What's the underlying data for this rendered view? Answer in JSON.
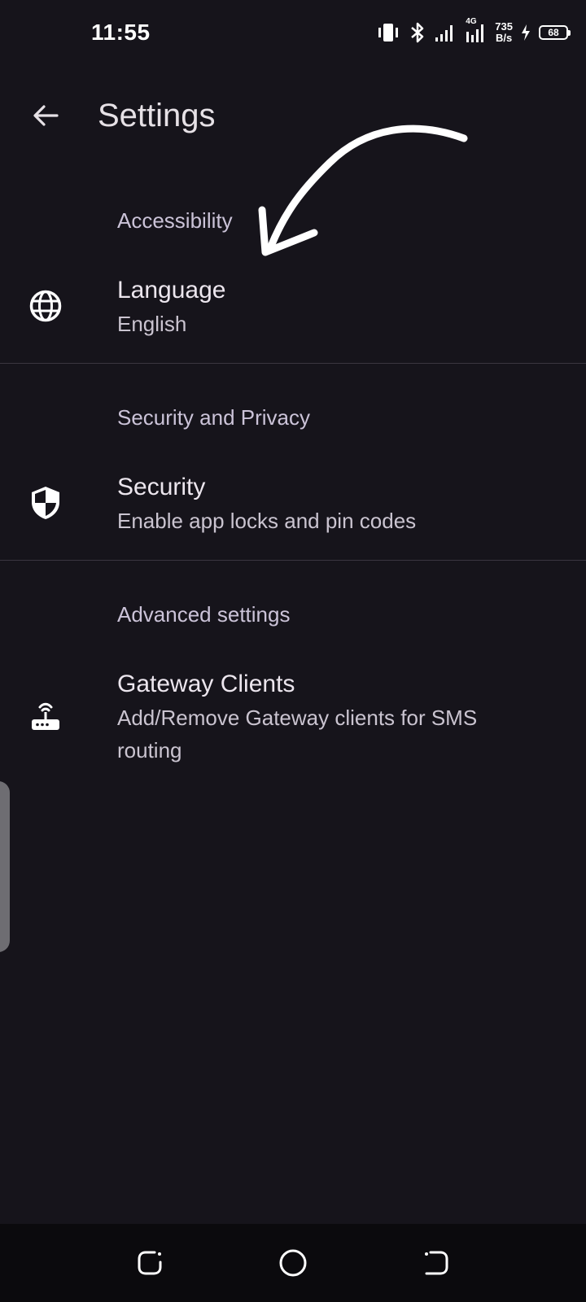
{
  "status_bar": {
    "time": "11:55",
    "network_speed_value": "735",
    "network_speed_unit": "B/s",
    "network_type": "4G",
    "battery_level": "68"
  },
  "app_bar": {
    "title": "Settings",
    "back_icon": "arrow-back-icon"
  },
  "sections": [
    {
      "header": "Accessibility",
      "item": {
        "title": "Language",
        "summary": "English",
        "icon": "globe-icon"
      }
    },
    {
      "header": "Security and Privacy",
      "item": {
        "title": "Security",
        "summary": "Enable app locks and pin codes",
        "icon": "shield-icon"
      }
    },
    {
      "header": "Advanced settings",
      "item": {
        "title": "Gateway Clients",
        "summary": "Add/Remove Gateway clients for SMS routing",
        "icon": "router-icon"
      }
    }
  ],
  "annotation": {
    "icon": "hand-drawn-arrow",
    "color": "#ffffff"
  },
  "nav_bar": {
    "recents_icon": "recents-icon",
    "home_icon": "home-circle-icon",
    "back_icon": "nav-back-icon"
  },
  "colors": {
    "background": "#16141b",
    "text_primary": "#ece6ee",
    "text_secondary": "#cac4d0",
    "divider": "#3a3640",
    "nav_background": "#0b0a0d"
  }
}
